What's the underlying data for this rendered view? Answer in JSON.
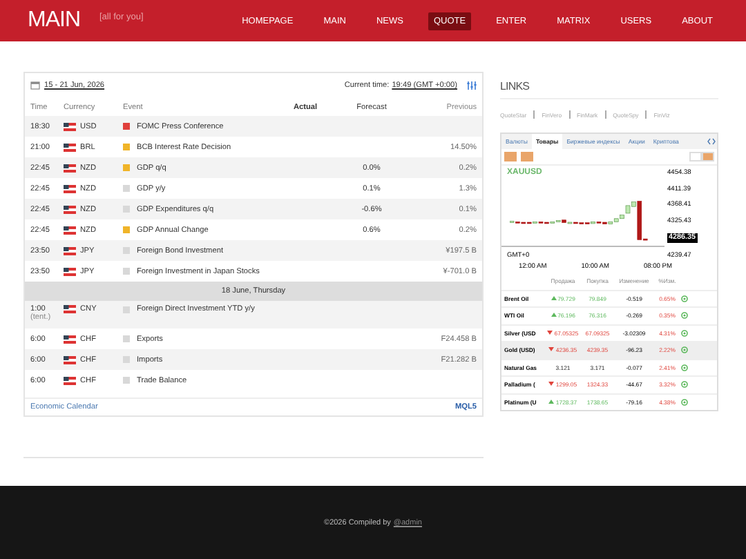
{
  "header": {
    "logo": "MAIN",
    "tagline": "[all for you]",
    "nav": [
      {
        "label": "HOMEPAGE",
        "selected": false
      },
      {
        "label": "MAIN",
        "selected": false
      },
      {
        "label": "NEWS",
        "selected": false
      },
      {
        "label": "QUOTE",
        "selected": true
      },
      {
        "label": "ENTER",
        "selected": false
      },
      {
        "label": "MATRIX",
        "selected": false
      },
      {
        "label": "USERS",
        "selected": false
      },
      {
        "label": "ABOUT",
        "selected": false
      }
    ]
  },
  "calendar": {
    "date_range": "15 - 21 Jun, 2026",
    "current_time_label": "Current time:",
    "current_time": "19:49 (GMT +0:00)",
    "columns": [
      "Time",
      "Currency",
      "Event",
      "Actual",
      "Forecast",
      "Previous"
    ],
    "rows": [
      {
        "kind": "event",
        "time": "18:30",
        "currency": "USD",
        "color": "#e0403c",
        "event": "FOMC Press Conference"
      },
      {
        "kind": "event",
        "time": "21:00",
        "currency": "BRL",
        "color": "#f0b429",
        "event": "BCB Interest Rate Decision",
        "previous": "14.50%"
      },
      {
        "kind": "event",
        "time": "22:45",
        "currency": "NZD",
        "color": "#f0b429",
        "event": "GDP q/q",
        "forecast": "0.0%",
        "previous": "0.2%"
      },
      {
        "kind": "event",
        "time": "22:45",
        "currency": "NZD",
        "color": "#d8d8d8",
        "event": "GDP y/y",
        "forecast": "0.1%",
        "previous": "1.3%"
      },
      {
        "kind": "event",
        "time": "22:45",
        "currency": "NZD",
        "color": "#d8d8d8",
        "event": "GDP Expenditures q/q",
        "forecast": "-0.6%",
        "previous": "0.1%"
      },
      {
        "kind": "event",
        "time": "22:45",
        "currency": "NZD",
        "color": "#f0b429",
        "event": "GDP Annual Change",
        "forecast": "0.6%",
        "previous": "0.2%"
      },
      {
        "kind": "event",
        "time": "23:50",
        "currency": "JPY",
        "color": "#d8d8d8",
        "event": "Foreign Bond Investment",
        "previous": "¥197.5 B"
      },
      {
        "kind": "event",
        "time": "23:50",
        "currency": "JPY",
        "color": "#d8d8d8",
        "event": "Foreign Investment in Japan Stocks",
        "previous": "¥-701.0 B"
      },
      {
        "kind": "day",
        "label": "18 June, Thursday"
      },
      {
        "kind": "event",
        "time": "1:00",
        "time_note": "(tent.)",
        "currency": "CNY",
        "color": "#d8d8d8",
        "event": "Foreign Direct Investment YTD y/y"
      },
      {
        "kind": "event",
        "time": "6:00",
        "currency": "CHF",
        "color": "#d8d8d8",
        "event": "Exports",
        "previous": "F24.458 B"
      },
      {
        "kind": "event",
        "time": "6:00",
        "currency": "CHF",
        "color": "#d8d8d8",
        "event": "Imports",
        "previous": "F21.282 B"
      },
      {
        "kind": "event",
        "time": "6:00",
        "currency": "CHF",
        "color": "#d8d8d8",
        "event": "Trade Balance"
      }
    ],
    "footer_link": "Economic Calendar",
    "brand": "MQL5"
  },
  "links": {
    "title": "LINKS",
    "items": [
      "QuoteStar",
      "FinVero",
      "FinMark",
      "QuoteSpy",
      "FinViz"
    ]
  },
  "widget": {
    "tabs": [
      {
        "label": "Валюты",
        "selected": false
      },
      {
        "label": "Товары",
        "selected": true
      },
      {
        "label": "Биржевые индексы",
        "selected": false
      },
      {
        "label": "Акции",
        "selected": false
      },
      {
        "label": "Криптова",
        "selected": false
      }
    ],
    "symbol": "XAUUSD",
    "price_ticks": [
      "4454.38",
      "4411.39",
      "4368.41",
      "4325.43",
      "4239.47"
    ],
    "current_price": "4286.35",
    "timezone": "GMT+0",
    "time_ticks": [
      "12:00 AM",
      "10:00 AM",
      "08:00 PM"
    ],
    "columns": [
      "Продажа",
      "Покупка",
      "Изменение",
      "%Изм."
    ],
    "rows": [
      {
        "name": "Brent Oil",
        "kind": "up",
        "bid": "79.729",
        "ask": "79.849",
        "change": "-0.519",
        "pct": "0.65%",
        "selected": false
      },
      {
        "name": "WTI Oil",
        "kind": "up",
        "bid": "76.196",
        "ask": "76.316",
        "change": "-0.269",
        "pct": "0.35%",
        "selected": false
      },
      {
        "name": "Silver (USD",
        "kind": "down",
        "bid": "67.05325",
        "ask": "67.09325",
        "change": "-3.02309",
        "pct": "4.31%",
        "selected": false
      },
      {
        "name": "Gold (USD)",
        "kind": "down",
        "bid": "4236.35",
        "ask": "4239.35",
        "change": "-96.23",
        "pct": "2.22%",
        "selected": true
      },
      {
        "name": "Natural Gas",
        "kind": "flat",
        "bid": "3.121",
        "ask": "3.171",
        "change": "-0.077",
        "pct": "2.41%",
        "selected": false
      },
      {
        "name": "Palladium (",
        "kind": "down",
        "bid": "1299.05",
        "ask": "1324.33",
        "change": "-44.67",
        "pct": "3.32%",
        "selected": false
      },
      {
        "name": "Platinum (U",
        "kind": "up",
        "bid": "1728.37",
        "ask": "1738.65",
        "change": "-79.16",
        "pct": "4.38%",
        "selected": false
      }
    ]
  },
  "footer": {
    "text": "©2026 Compiled by",
    "link": "@admin"
  }
}
